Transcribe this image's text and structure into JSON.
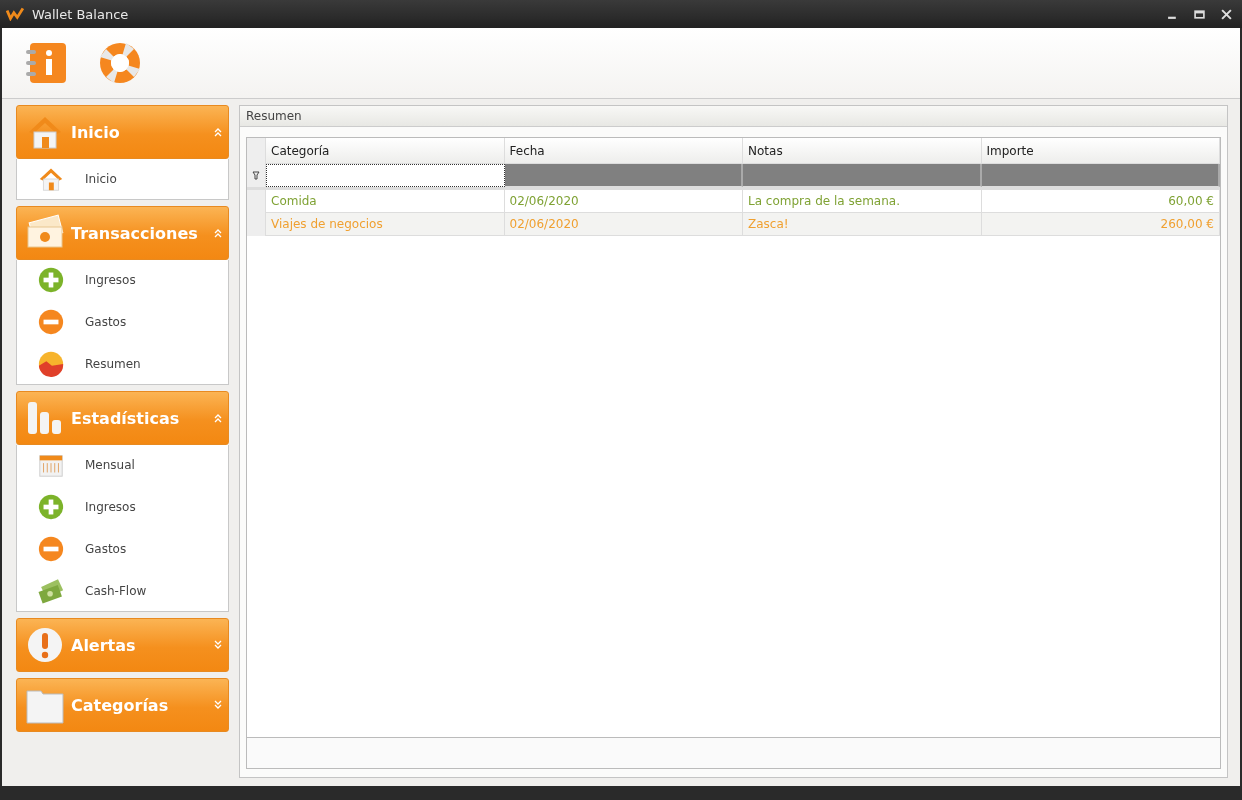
{
  "window": {
    "title": "Wallet Balance"
  },
  "sidebar": {
    "groups": [
      {
        "title": "Inicio",
        "kind": "house",
        "expanded": true,
        "items": [
          {
            "label": "Inicio",
            "kind": "house"
          }
        ]
      },
      {
        "title": "Transacciones",
        "kind": "bills",
        "expanded": true,
        "items": [
          {
            "label": "Ingresos",
            "kind": "plus"
          },
          {
            "label": "Gastos",
            "kind": "minus"
          },
          {
            "label": "Resumen",
            "kind": "pie"
          }
        ]
      },
      {
        "title": "Estadísticas",
        "kind": "bars",
        "expanded": true,
        "items": [
          {
            "label": "Mensual",
            "kind": "calendar"
          },
          {
            "label": "Ingresos",
            "kind": "plus"
          },
          {
            "label": "Gastos",
            "kind": "minus"
          },
          {
            "label": "Cash-Flow",
            "kind": "money"
          }
        ]
      },
      {
        "title": "Alertas",
        "kind": "alert",
        "expanded": false
      },
      {
        "title": "Categorías",
        "kind": "folder",
        "expanded": false
      }
    ]
  },
  "panel": {
    "title": "Resumen"
  },
  "table": {
    "columns": [
      "Categoría",
      "Fecha",
      "Notas",
      "Importe"
    ],
    "rows": [
      {
        "color": "#7fa234",
        "cells": [
          "Comida",
          "02/06/2020",
          "La compra de la semana.",
          "60,00 €"
        ]
      },
      {
        "color": "#f0a030",
        "cells": [
          "Viajes de negocios",
          "02/06/2020",
          "Zasca!",
          "260,00 €"
        ]
      }
    ]
  }
}
